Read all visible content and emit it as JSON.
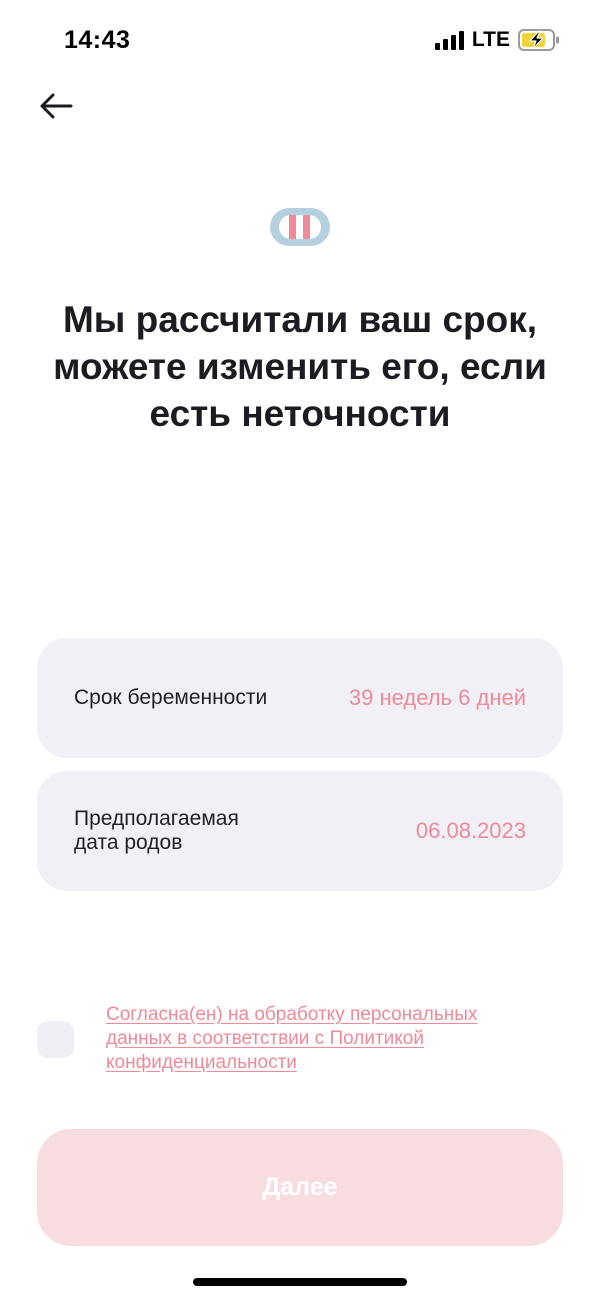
{
  "status_bar": {
    "time": "14:43",
    "network": "LTE",
    "icons": [
      "signal-icon",
      "battery-charging-icon"
    ]
  },
  "header": {
    "back_icon": "arrow-left-icon"
  },
  "logo": {
    "icon": "pregnancy-test-logo-icon",
    "colors": {
      "outer": "#b7d0df",
      "inner": "#ffffff",
      "stripes": "#ef8a99"
    }
  },
  "title": "Мы рассчитали ваш срок, можете изменить его, если есть неточности",
  "pregnancy_term": {
    "label": "Срок беременности",
    "value": "39 недель 6 дней"
  },
  "due_date": {
    "label": "Предполагаемая дата родов",
    "value": "06.08.2023"
  },
  "consent": {
    "checked": false,
    "text": "Согласна(ен) на обработку персональных данных в соответствии с Политикой конфиденциальности"
  },
  "next_button": {
    "label": "Далее",
    "enabled": false
  },
  "colors": {
    "accent": "#ef8a99",
    "card_background": "#f1f0f6",
    "button_disabled": "#f8dde0"
  }
}
